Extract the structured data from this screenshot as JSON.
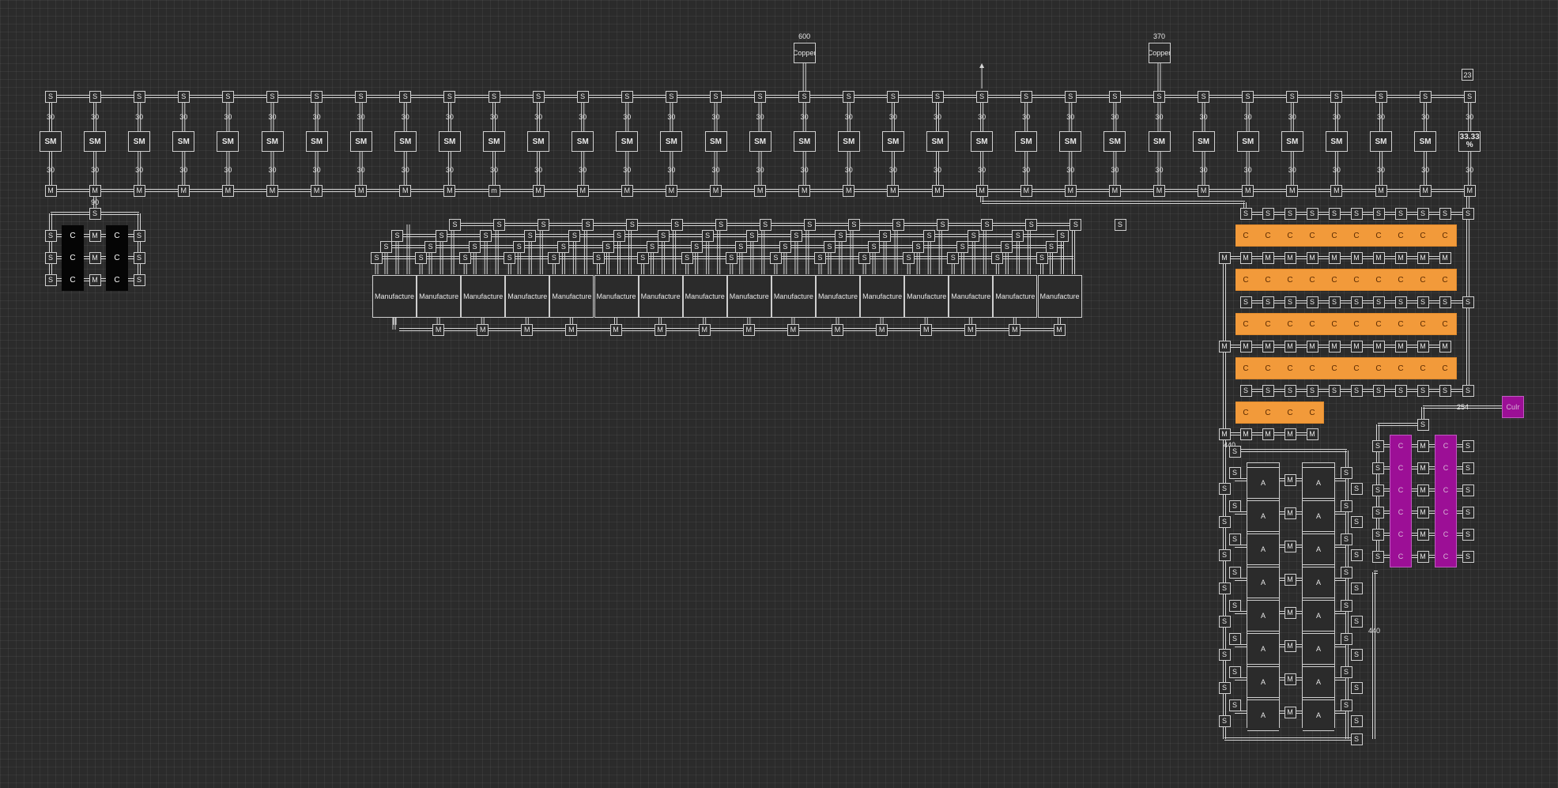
{
  "labels": {
    "splitter": "S",
    "merger": "M",
    "merger_alt": "m",
    "smelter": "SM",
    "constructor": "C",
    "assembler": "A",
    "manufacturer": "Manufacture",
    "rate": "30",
    "rate_black": "90"
  },
  "sources": [
    {
      "amount": "600",
      "name": "Copper"
    },
    {
      "amount": "370",
      "name": "Copper"
    }
  ],
  "top_right_count": "23",
  "last_smelter_label": "33.33\n%",
  "purple_source_label": "CuIr",
  "rate_purple": "254",
  "rate_assembly_a": "440",
  "rate_assembly_b": "440",
  "colors": {
    "background": "#2b2b2b",
    "wire": "#d6d6d6",
    "orange": "#f29a3a",
    "purple": "#9c0f96",
    "black": "#050505"
  }
}
